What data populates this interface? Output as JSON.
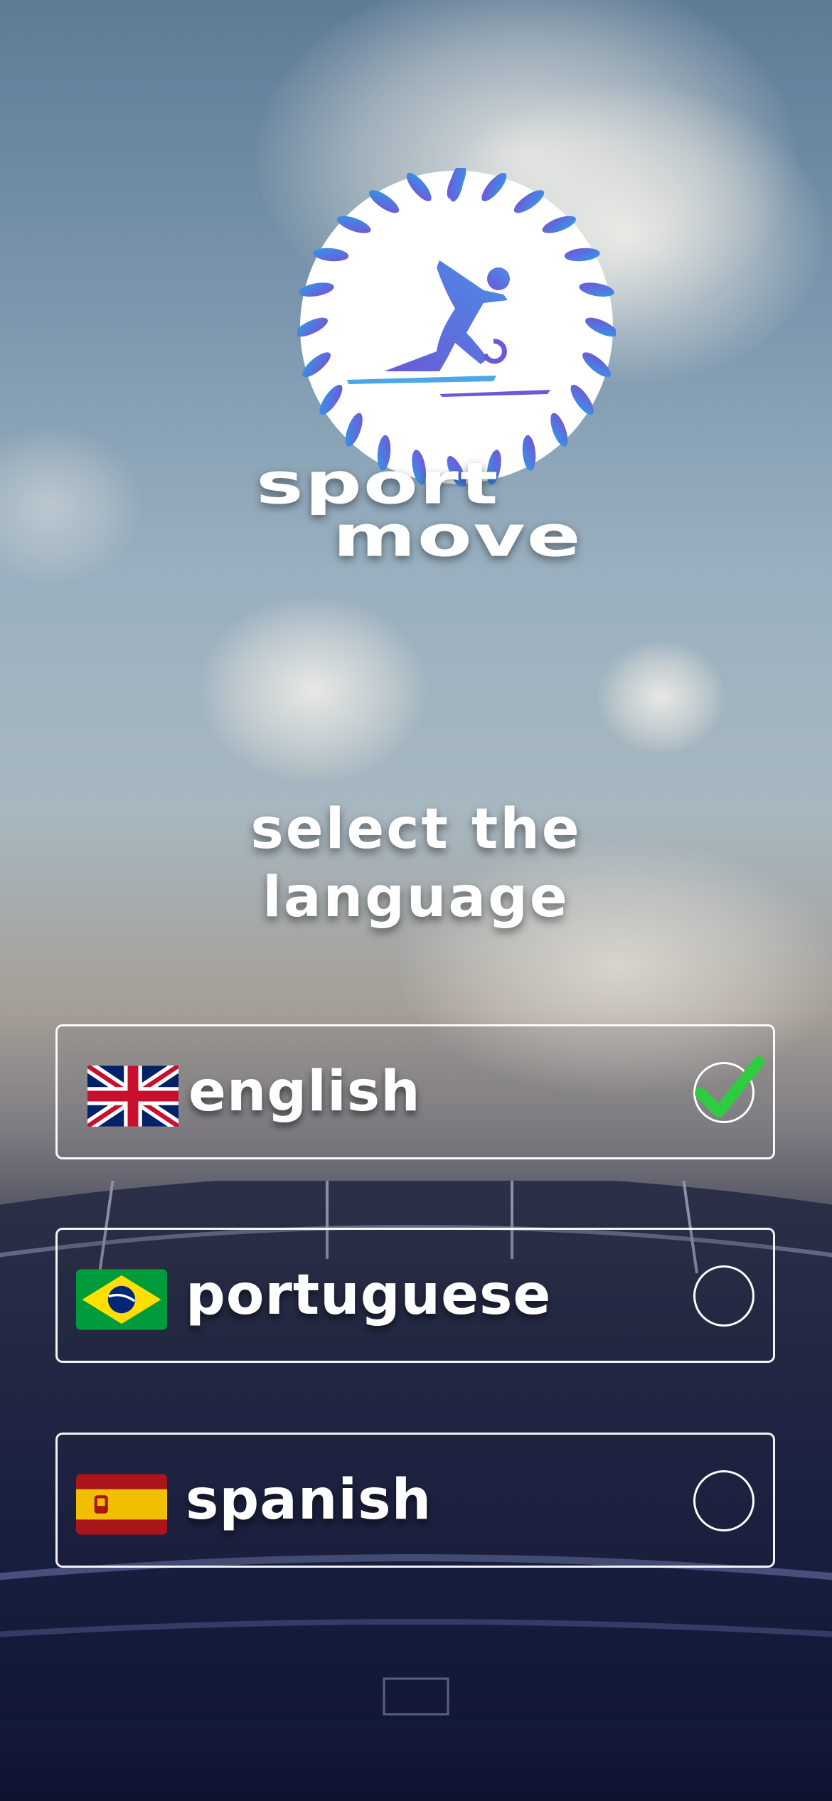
{
  "brand": {
    "line1": "sport",
    "line2": "move"
  },
  "heading": {
    "line1": "select the",
    "line2": "language"
  },
  "languages": [
    {
      "label": "english",
      "flag": "uk-flag-icon",
      "selected": true
    },
    {
      "label": "portuguese",
      "flag": "brazil-flag-icon",
      "selected": false
    },
    {
      "label": "spanish",
      "flag": "spain-flag-icon",
      "selected": false
    }
  ],
  "colors": {
    "check": "#2ecc40",
    "logo_ring_start": "#7a4fd6",
    "logo_ring_end": "#2f9be8",
    "text": "#ffffff"
  }
}
